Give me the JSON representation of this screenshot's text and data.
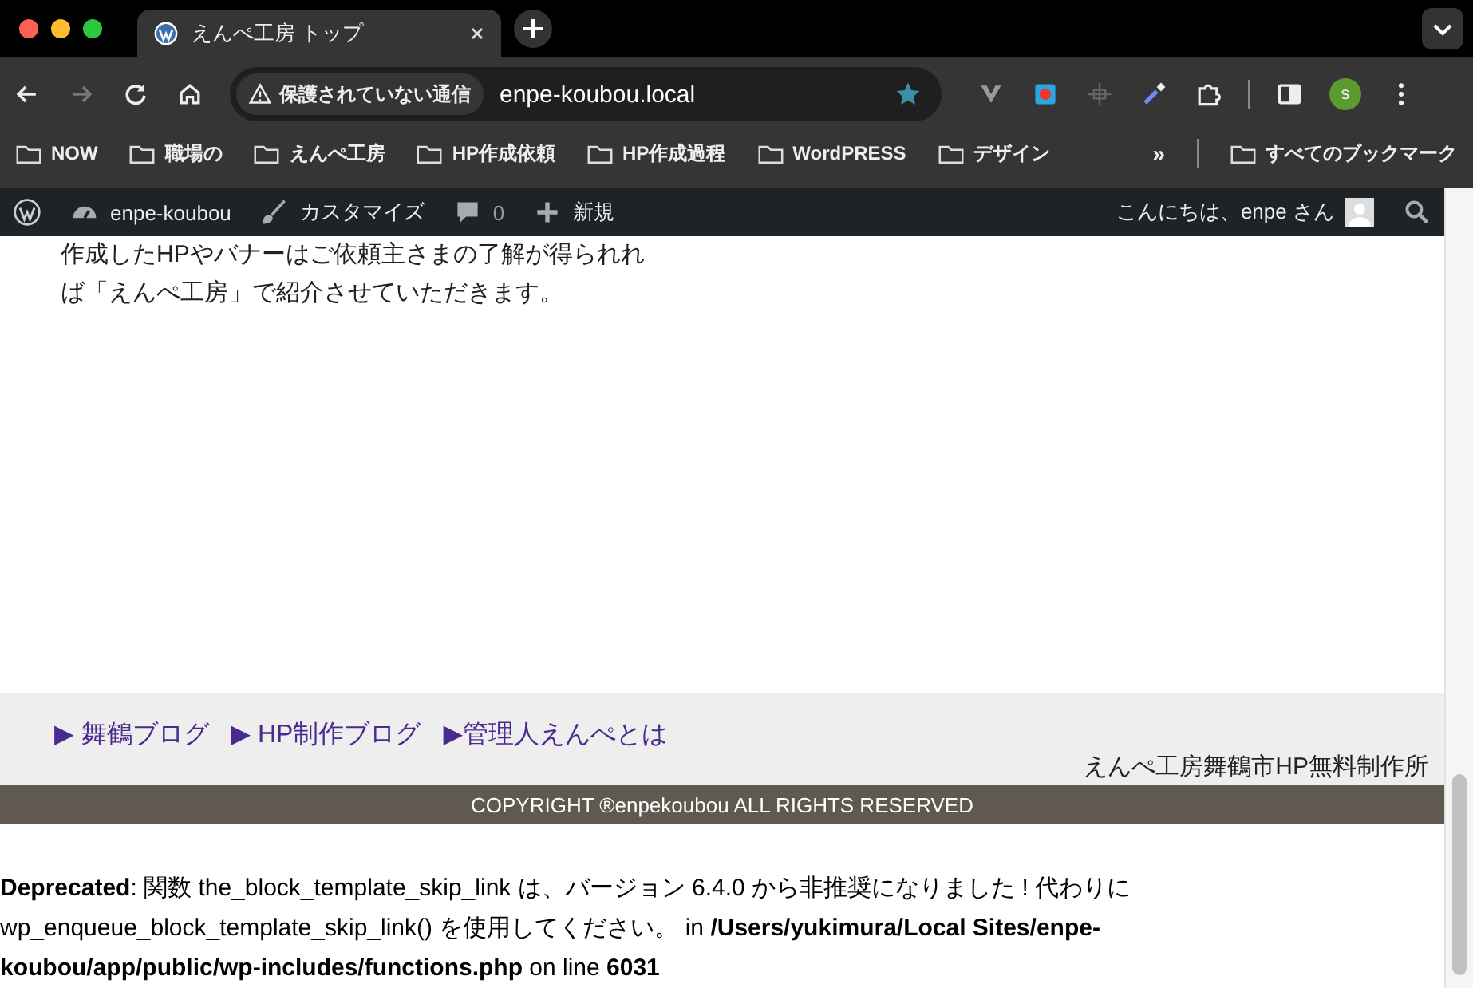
{
  "tab": {
    "title": "えんぺ工房 トップ"
  },
  "address_bar": {
    "security_label": "保護されていない通信",
    "url": "enpe-koubou.local"
  },
  "profile": {
    "initial": "s"
  },
  "bookmarks": [
    "NOW",
    "職場の",
    "えんぺ工房",
    "HP作成依頼",
    "HP作成過程",
    "WordPRESS",
    "デザイン"
  ],
  "bookmarks_overflow": "»",
  "all_bookmarks": "すべてのブックマーク",
  "admin_bar": {
    "site": "enpe-koubou",
    "customize": "カスタマイズ",
    "comments": "0",
    "new": "新規",
    "greeting": "こんにちは、enpe さん"
  },
  "content": {
    "lines": [
      "作成したHPやバナーはご依頼主さまの了解が得られれ",
      "ば「えんぺ工房」で紹介させていただきます。"
    ]
  },
  "footer": {
    "links": [
      "▶ 舞鶴ブログ",
      "▶ HP制作ブログ",
      "▶管理人えんぺとは"
    ],
    "site_name": "えんぺ工房舞鶴市HP無料制作所",
    "copyright": "COPYRIGHT ®enpekoubou ALL RIGHTS RESERVED"
  },
  "notice": "**Deprecated**: 関数 the_block_template_skip_link は、バージョン 6.4.0 から非推奨になりました ! 代わりに wp_enqueue_block_template_skip_link() を使用してください。 in **/Users/yukimura/Local Sites/enpe-koubou/app/public/wp-includes/functions.php** on line **6031**"
}
